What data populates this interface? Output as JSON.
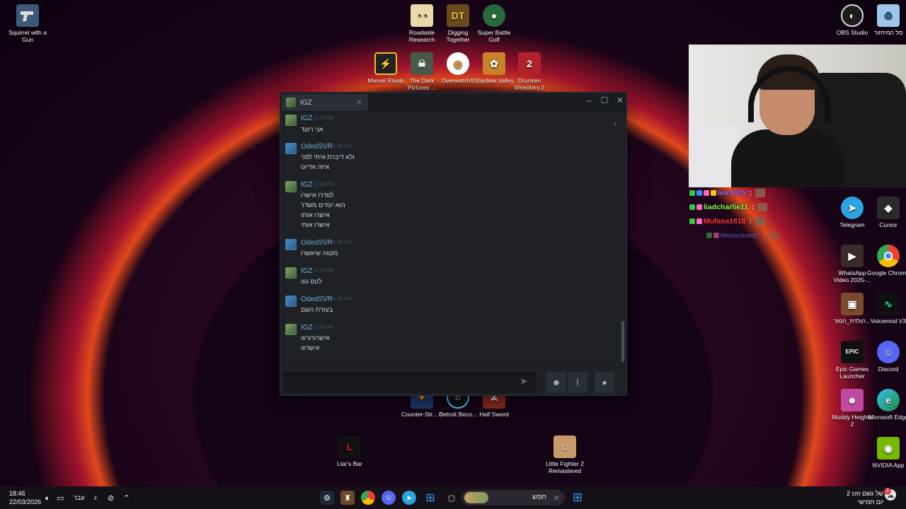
{
  "desktop": {
    "icons_left": [
      {
        "label": "Squirrel with a Gun",
        "icon": "pistol-icon"
      }
    ],
    "icons_top": [
      {
        "label": "Roadside Research",
        "icon": "roadside-research-icon"
      },
      {
        "label": "Digging Together",
        "icon": "digging-together-icon",
        "glyph": "DT"
      },
      {
        "label": "Super Battle Golf",
        "icon": "golf-icon"
      },
      {
        "label": "Marvel Rivals",
        "icon": "marvel-rivals-icon"
      },
      {
        "label": "The Dark Pictures ...",
        "icon": "dark-pictures-icon"
      },
      {
        "label": "Overwatch®",
        "icon": "overwatch-icon"
      },
      {
        "label": "Stardew Valley",
        "icon": "stardew-icon"
      },
      {
        "label": "Drunken Wrestlers 2",
        "icon": "drunken-wrestlers-icon",
        "glyph": "2"
      }
    ],
    "icons_right_top": [
      {
        "label": "OBS Studio",
        "icon": "obs-icon"
      },
      {
        "label": "סל המיחזור",
        "icon": "recycle-bin-icon"
      }
    ],
    "icons_right": [
      {
        "label": "Telegram",
        "icon": "telegram-icon"
      },
      {
        "label": "Cursor",
        "icon": "cursor-app-icon"
      },
      {
        "label": "WhatsApp Video 2025-...",
        "icon": "video-file-icon"
      },
      {
        "label": "Google Chrome",
        "icon": "chrome-icon"
      },
      {
        "label": "הולדת_הסוד...",
        "icon": "image-file-icon"
      },
      {
        "label": "Voicemod V3",
        "icon": "voicemod-icon"
      },
      {
        "label": "Epic Games Launcher",
        "icon": "epic-games-icon",
        "glyph": "EPIC"
      },
      {
        "label": "Discord",
        "icon": "discord-icon"
      },
      {
        "label": "Muddy Heights 2",
        "icon": "muddy-heights-icon"
      },
      {
        "label": "Microsoft Edge",
        "icon": "edge-icon"
      },
      {
        "label": "NVIDIA App",
        "icon": "nvidia-icon"
      }
    ],
    "icons_bottom": [
      {
        "label": "Counter-Str... 2",
        "icon": "counter-strike-icon"
      },
      {
        "label": "Detroit Beco...",
        "icon": "detroit-icon"
      },
      {
        "label": "Half Sword",
        "icon": "half-sword-icon"
      },
      {
        "label": "Liar's Bar",
        "icon": "liars-bar-icon"
      },
      {
        "label": "Little Fighter 2 Remastered",
        "icon": "little-fighter-icon"
      }
    ]
  },
  "stream_chat": [
    {
      "user": "lior1605",
      "color": "#9b6bff"
    },
    {
      "user": "liadcharlie11",
      "color": "#7cff4a"
    },
    {
      "user": "Mufasa1818",
      "color": "#ff3a3a"
    },
    {
      "user": "Menachem17",
      "color": "#6a7bff"
    }
  ],
  "chat_window": {
    "tab_name": "IGZ",
    "pin_label": "+",
    "messages": [
      {
        "user": "IGZ",
        "time": "6:35 PM",
        "lines": [
          "אני רועד"
        ]
      },
      {
        "user": "OdedSVR",
        "time": "6:35 PM",
        "lines": [
          "ולא דיברת איתי לפני",
          "איזה אדיוט"
        ]
      },
      {
        "user": "IGZ",
        "time": "6:35 PM",
        "lines": [
          "לפדרו אישרו",
          "הוא יומיים משדר",
          "אישרו אותו",
          "אישרו אותי"
        ]
      },
      {
        "user": "OdedSVR",
        "time": "6:35 PM",
        "lines": [
          "מקווה שיאשרו"
        ]
      },
      {
        "user": "IGZ",
        "time": "6:35 PM",
        "lines": [
          "לטס גווו"
        ]
      },
      {
        "user": "OdedSVR",
        "time": "6:35 PM",
        "lines": [
          "בעזרת השם"
        ]
      },
      {
        "user": "IGZ",
        "time": "6:35 PM",
        "lines": [
          "אישרורורווו",
          "אישרווו"
        ]
      }
    ],
    "input_value": ""
  },
  "taskbar": {
    "time": "18:46",
    "date": "22/03/2026",
    "language": "עבר",
    "search_placeholder": "חפש",
    "weather_line1": "2 cm של גשם",
    "weather_line2": "יום חמישי",
    "notification_count": "1"
  }
}
